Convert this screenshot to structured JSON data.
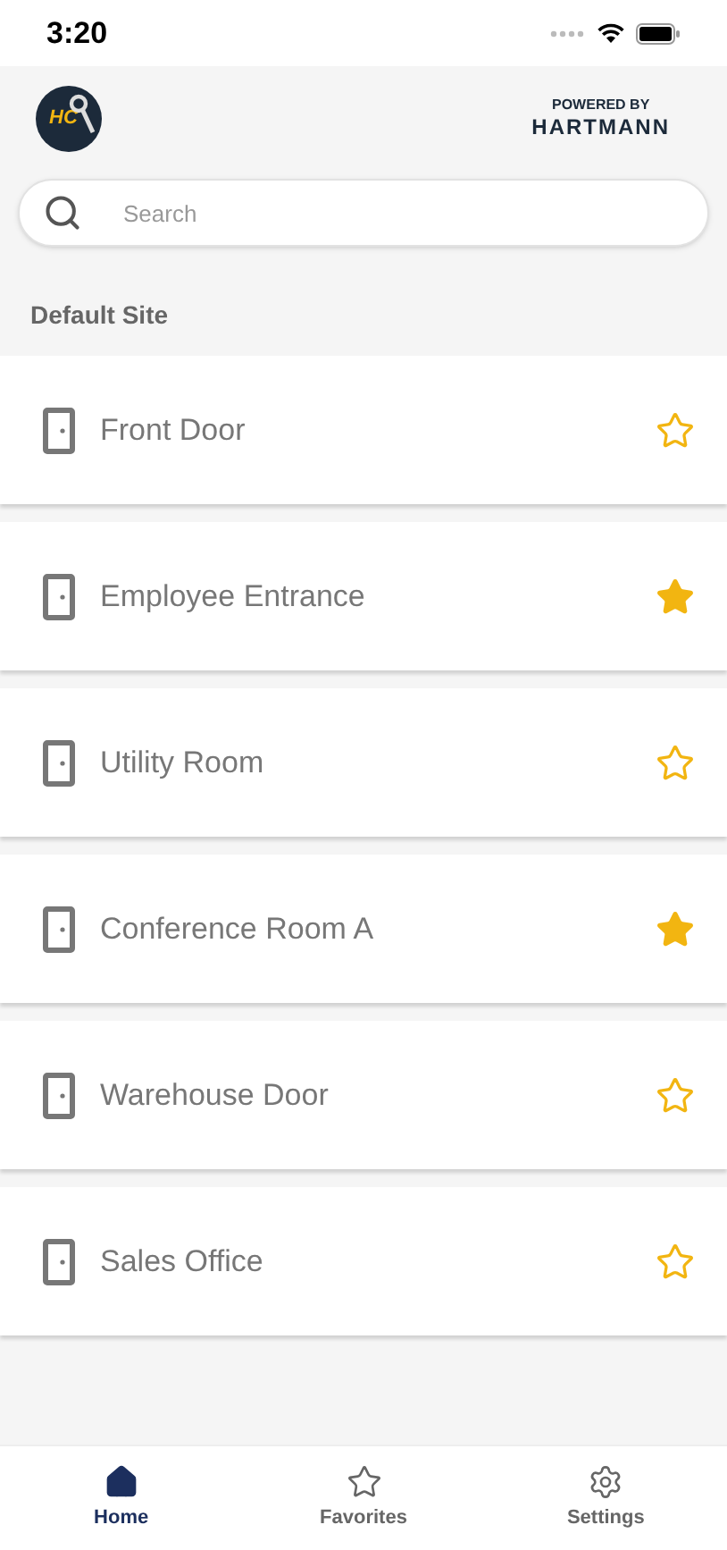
{
  "status_bar": {
    "time": "3:20"
  },
  "header": {
    "logo_text": "HC",
    "powered_by": "POWERED BY",
    "brand": "HARTMANN"
  },
  "search": {
    "placeholder": "Search"
  },
  "section": {
    "title": "Default Site"
  },
  "doors": [
    {
      "name": "Front Door",
      "favorite": false
    },
    {
      "name": "Employee Entrance",
      "favorite": true
    },
    {
      "name": "Utility Room",
      "favorite": false
    },
    {
      "name": "Conference Room A",
      "favorite": true
    },
    {
      "name": "Warehouse Door",
      "favorite": false
    },
    {
      "name": "Sales Office",
      "favorite": false
    }
  ],
  "tab_bar": [
    {
      "kind": "home",
      "label": "Home",
      "selected": true
    },
    {
      "kind": "favorites",
      "label": "Favorites",
      "selected": false
    },
    {
      "kind": "settings",
      "label": "Settings",
      "selected": false
    }
  ]
}
